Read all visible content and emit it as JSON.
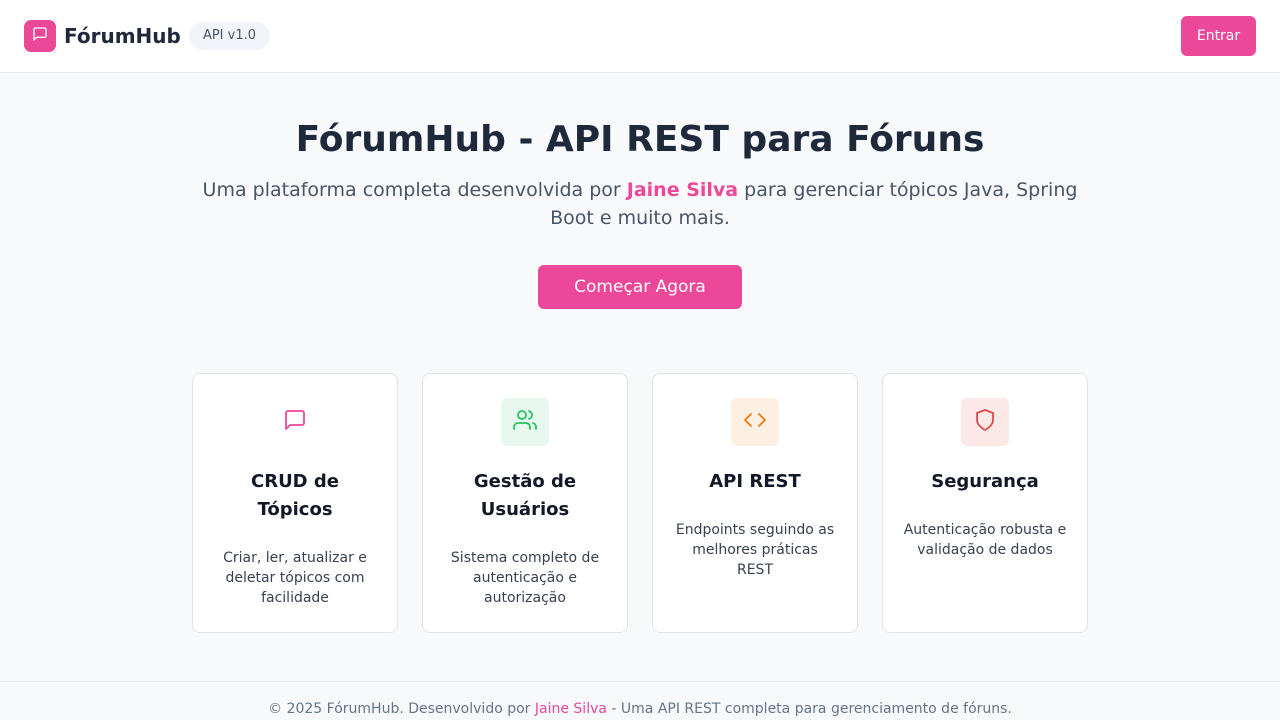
{
  "header": {
    "brand_name": "FórumHub",
    "brand_icon": "chat-bubble-icon",
    "api_badge": "API v1.0",
    "login_label": "Entrar"
  },
  "hero": {
    "title": "FórumHub - API REST para Fóruns",
    "subtitle_before": "Uma plataforma completa desenvolvida por ",
    "subtitle_author": "Jaine Silva",
    "subtitle_after": " para gerenciar tópicos Java, Spring Boot e muito mais.",
    "cta_label": "Começar Agora"
  },
  "features": [
    {
      "title": "CRUD de Tópicos",
      "description": "Criar, ler, atualizar e deletar tópicos com facilidade",
      "icon": "chat-bubble-icon",
      "icon_color": "#ec4899",
      "icon_bg": "#ffffff"
    },
    {
      "title": "Gestão de Usuários",
      "description": "Sistema completo de autenticação e autorização",
      "icon": "users-icon",
      "icon_color": "#22c55e",
      "icon_bg": "#e8f8ee"
    },
    {
      "title": "API REST",
      "description": "Endpoints seguindo as melhores práticas REST",
      "icon": "code-icon",
      "icon_color": "#ea7a12",
      "icon_bg": "#fdf0e2"
    },
    {
      "title": "Segurança",
      "description": "Autenticação robusta e validação de dados",
      "icon": "shield-icon",
      "icon_color": "#dc4a4a",
      "icon_bg": "#fde8e8"
    }
  ],
  "footer": {
    "text_before": "© 2025 FórumHub. Desenvolvido por ",
    "author": "Jaine Silva",
    "text_after": " - Uma API REST completa para gerenciamento de fóruns."
  },
  "colors": {
    "accent": "#ec4899",
    "text_primary": "#1e293b",
    "text_secondary": "#475569"
  }
}
